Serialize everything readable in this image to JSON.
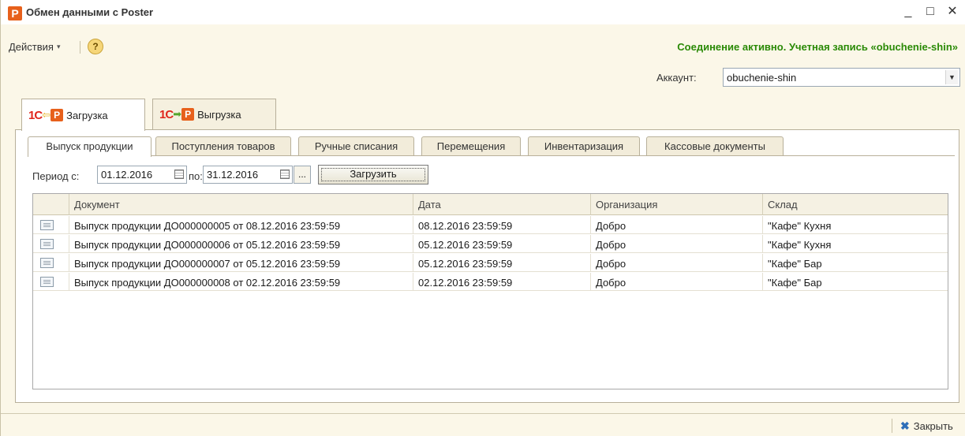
{
  "window": {
    "app_icon": "P",
    "title": "Обмен данными с Poster",
    "minimize": "_",
    "maximize": "□",
    "close": "✕"
  },
  "toolbar": {
    "actions_label": "Действия",
    "actions_caret": "▾",
    "help_label": "?",
    "status": "Соединение активно. Учетная запись «obuchenie-shin»"
  },
  "account": {
    "label": "Аккаунт:",
    "value": "obuchenie-shin",
    "arrow": "▼"
  },
  "main_tabs": [
    {
      "logo": "1С",
      "arrow": "⇦",
      "badge": "P",
      "label": "Загрузка",
      "active": true
    },
    {
      "logo": "1С",
      "arrow": "➡",
      "badge": "P",
      "label": "Выгрузка",
      "active": false
    }
  ],
  "sub_tabs": [
    {
      "label": "Выпуск продукции",
      "active": true
    },
    {
      "label": "Поступления товаров",
      "active": false
    },
    {
      "label": "Ручные списания",
      "active": false
    },
    {
      "label": "Перемещения",
      "active": false
    },
    {
      "label": "Инвентаризация",
      "active": false
    },
    {
      "label": "Кассовые документы",
      "active": false
    }
  ],
  "period": {
    "from_label": "Период с:",
    "from_value": "01.12.2016",
    "to_label": "по:",
    "to_value": "31.12.2016",
    "dots_label": "...",
    "load_label": "Загрузить"
  },
  "table": {
    "columns": [
      "Документ",
      "Дата",
      "Организация",
      "Склад"
    ],
    "rows": [
      {
        "document": "Выпуск продукции ДО000000005 от 08.12.2016 23:59:59",
        "date": "08.12.2016 23:59:59",
        "org": "Добро",
        "warehouse": "\"Кафе\" Кухня"
      },
      {
        "document": "Выпуск продукции ДО000000006 от 05.12.2016 23:59:59",
        "date": "05.12.2016 23:59:59",
        "org": "Добро",
        "warehouse": "\"Кафе\" Кухня"
      },
      {
        "document": "Выпуск продукции ДО000000007 от 05.12.2016 23:59:59",
        "date": "05.12.2016 23:59:59",
        "org": "Добро",
        "warehouse": "\"Кафе\" Бар"
      },
      {
        "document": "Выпуск продукции ДО000000008 от 02.12.2016 23:59:59",
        "date": "02.12.2016 23:59:59",
        "org": "Добро",
        "warehouse": "\"Кафе\" Бар"
      }
    ]
  },
  "footer": {
    "close_icon": "✖",
    "close_label": "Закрыть"
  },
  "colors": {
    "status_green": "#2a8a06",
    "brand_orange": "#e7601b",
    "logo_red": "#e0261c",
    "window_bg": "#fbf7e8"
  }
}
